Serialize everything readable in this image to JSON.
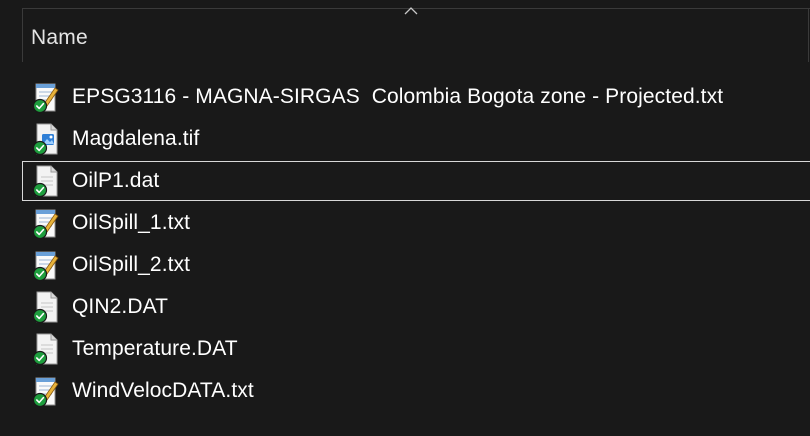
{
  "header": {
    "name_column": "Name"
  },
  "files": [
    {
      "name": "EPSG3116 - MAGNA-SIRGAS  Colombia Bogota zone - Projected.txt",
      "icon": "notepad-icon",
      "selected": false
    },
    {
      "name": "Magdalena.tif",
      "icon": "image-file-icon",
      "selected": false
    },
    {
      "name": "OilP1.dat",
      "icon": "generic-file-icon",
      "selected": true
    },
    {
      "name": "OilSpill_1.txt",
      "icon": "notepad-icon",
      "selected": false
    },
    {
      "name": "OilSpill_2.txt",
      "icon": "notepad-icon",
      "selected": false
    },
    {
      "name": "QIN2.DAT",
      "icon": "generic-file-icon",
      "selected": false
    },
    {
      "name": "Temperature.DAT",
      "icon": "generic-file-icon",
      "selected": false
    },
    {
      "name": "WindVelocDATA.txt",
      "icon": "notepad-icon",
      "selected": false
    }
  ],
  "colors": {
    "background": "#191919",
    "sync_badge": "#1e9e3e",
    "selection_border": "#d8d8d8"
  }
}
